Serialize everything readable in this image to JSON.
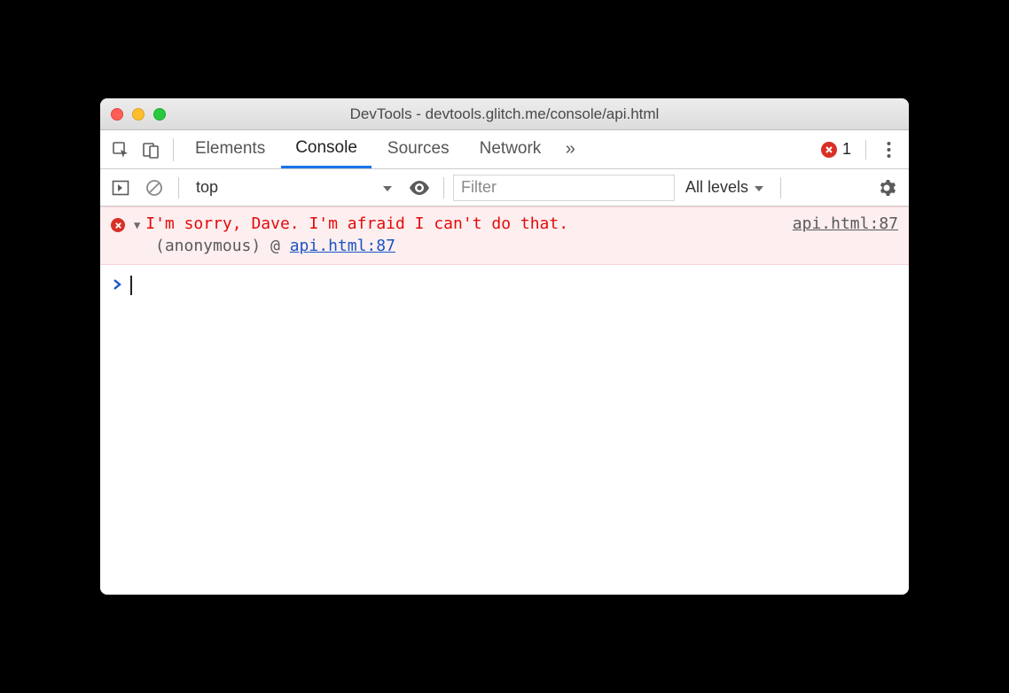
{
  "window": {
    "title": "DevTools - devtools.glitch.me/console/api.html"
  },
  "tabs": {
    "items": [
      "Elements",
      "Console",
      "Sources",
      "Network"
    ],
    "active_index": 1,
    "overflow_glyph": "»"
  },
  "error_indicator": {
    "count": "1"
  },
  "filterbar": {
    "context": "top",
    "filter_placeholder": "Filter",
    "levels_label": "All levels"
  },
  "console": {
    "error": {
      "message": "I'm sorry, Dave. I'm afraid I can't do that.",
      "source": "api.html:87",
      "stack_prefix": "(anonymous) @ ",
      "stack_link": "api.html:87"
    },
    "prompt_glyph": ">"
  }
}
